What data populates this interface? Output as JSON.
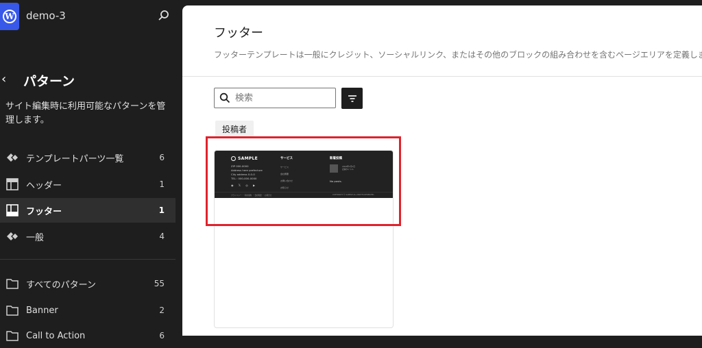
{
  "site": {
    "name": "demo-3"
  },
  "sidebar": {
    "title": "パターン",
    "description": "サイト編集時に利用可能なパターンを管理します。",
    "items": [
      {
        "label": "テンプレートパーツ一覧",
        "count": "6",
        "icon": "diamond-icon"
      },
      {
        "label": "ヘッダー",
        "count": "1",
        "icon": "header-layout-icon"
      },
      {
        "label": "フッター",
        "count": "1",
        "icon": "footer-layout-icon",
        "active": true
      },
      {
        "label": "一般",
        "count": "4",
        "icon": "diamond-icon"
      },
      {
        "label": "すべてのパターン",
        "count": "55",
        "icon": "folder-icon"
      },
      {
        "label": "Banner",
        "count": "2",
        "icon": "folder-icon"
      },
      {
        "label": "Call to Action",
        "count": "6",
        "icon": "folder-icon"
      }
    ]
  },
  "main": {
    "title": "フッター",
    "description": "フッターテンプレートは一般にクレジット、ソーシャルリンク、またはその他のブロックの組み合わせを含むページエリアを定義します。",
    "search_placeholder": "検索",
    "author_chip": "投稿者"
  },
  "preview": {
    "logo": "SAMPLE",
    "address_lines": [
      "ZIP 000-0000",
      "Address here prefecture",
      "City address 0-0-0",
      "TEL : 000-000-0000"
    ],
    "social": "◉ 𝕏 ◎ ▶",
    "services_title": "サービス",
    "service_links": [
      "サービス",
      "会社概要",
      "お問い合わせ",
      "お知らせ"
    ],
    "posts_title": "新着投稿",
    "post_lines": [
      "2024年1月1日",
      "記事タイトル"
    ],
    "no_posts": "No posts.",
    "bottom_links": "プライバシー ・ 利用規約 ・ 会社概要 ・ お問合せ",
    "copyright": "COPYRIGHT © SAMPLE ALL RIGHTS RESERVED."
  },
  "colors": {
    "accent": "#3858e9",
    "highlight": "#e0222b",
    "sidebar_bg": "#1e1e1e"
  }
}
